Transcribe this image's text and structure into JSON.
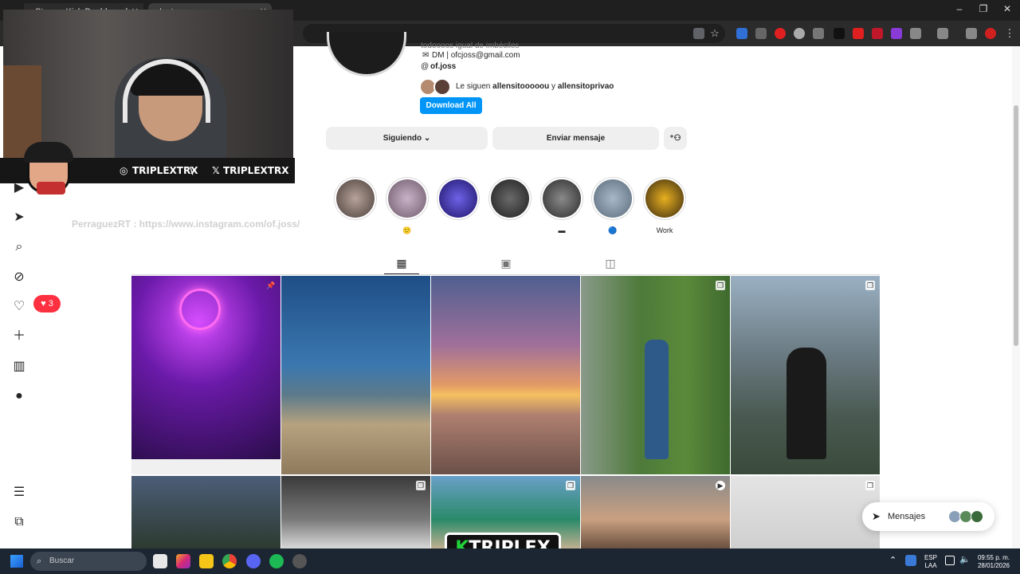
{
  "browser": {
    "tabs": [
      {
        "title": "Stream Kick Dashboard"
      },
      {
        "title": "Instagram"
      }
    ],
    "window_controls": [
      "minimize",
      "restore",
      "close"
    ]
  },
  "overlay": {
    "social": [
      {
        "platform": "instagram",
        "handle": "TRIPLEXTRX"
      },
      {
        "platform": "x",
        "handle": "TRIPLEXTRX"
      }
    ],
    "separator": "\\",
    "watermark": "PerraguezRT : https://www.instagram.com/of.joss/"
  },
  "sidebar": {
    "items": [
      {
        "icon": "reels-icon"
      },
      {
        "icon": "messages-icon"
      },
      {
        "icon": "search-icon"
      },
      {
        "icon": "explore-icon"
      },
      {
        "icon": "notifications-icon"
      },
      {
        "icon": "create-icon"
      },
      {
        "icon": "dashboard-icon"
      },
      {
        "icon": "profile-icon"
      }
    ],
    "notification_count": "3",
    "more_icon": "menu-icon",
    "also_from_meta_icon": "meta-apps-icon"
  },
  "profile": {
    "bio_cut": "todoooos igual de imbéciles",
    "email_line": "DM | ofcjoss@gmail.com",
    "threads_handle": "of.joss",
    "followed_by_prefix": "Le siguen",
    "followed_by_1": "allensitooooou",
    "followed_by_conj": "y",
    "followed_by_2": "allensitoprivao",
    "download_button": "Download All",
    "following_button": "Siguiendo",
    "message_button": "Enviar mensaje"
  },
  "highlights": [
    {
      "label": ""
    },
    {
      "label": "🙂"
    },
    {
      "label": ""
    },
    {
      "label": ""
    },
    {
      "label": "▬"
    },
    {
      "label": "🔵"
    },
    {
      "label": "Work"
    }
  ],
  "tabs": [
    {
      "name": "posts",
      "icon": "grid-icon",
      "active": true
    },
    {
      "name": "reels",
      "icon": "reels-icon",
      "active": false
    },
    {
      "name": "tagged",
      "icon": "tagged-icon",
      "active": false
    }
  ],
  "messages_pill": {
    "label": "Mensajes"
  },
  "stream_logo": {
    "k": "K",
    "text": "TRIPLEX"
  },
  "taskbar": {
    "search_placeholder": "Buscar",
    "lang_top": "ESP",
    "lang_bottom": "LAA",
    "time": "09:55 p. m.",
    "date": "28/01/2026"
  },
  "colors": {
    "instagram_blue": "#0095f6",
    "notification_red": "#ff3040",
    "brand_green": "#22d33b"
  }
}
